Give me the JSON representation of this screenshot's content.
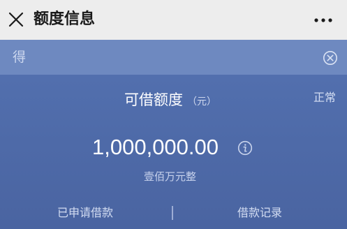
{
  "header": {
    "title": "额度信息",
    "close_icon": "close-icon",
    "more_icon": "more-dots-icon"
  },
  "notice": {
    "text": "得",
    "close_icon": "circle-close-icon"
  },
  "quota": {
    "label": "可借额度",
    "unit": "（元）",
    "status": "正常",
    "amount": "1,000,000.00",
    "amount_in_words": "壹佰万元整",
    "info_icon": "info-icon"
  },
  "footer": {
    "applied_loans": "已申请借款",
    "divider": "|",
    "loan_records": "借款记录"
  },
  "colors": {
    "topbar_bg": "#ededed",
    "panel_bg": "#4f6caa",
    "notice_bg": "#6e89c0",
    "text_primary": "#ffffff",
    "text_secondary": "#cfd8ee"
  }
}
